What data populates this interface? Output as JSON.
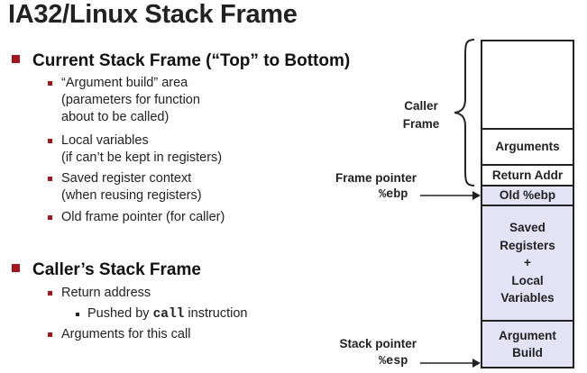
{
  "title": "IA32/Linux Stack Frame",
  "section1": {
    "heading": "Current Stack Frame (“Top” to Bottom)",
    "items": [
      {
        "line1": "“Argument build” area",
        "line2": "(parameters for function",
        "line3": "about to be called)"
      },
      {
        "line1": "Local variables",
        "line2": "(if can’t be kept in registers)"
      },
      {
        "line1": "Saved register context",
        "line2": "(when reusing registers)"
      },
      {
        "line1": "Old frame pointer (for caller)"
      }
    ]
  },
  "section2": {
    "heading": "Caller’s Stack Frame",
    "items": [
      {
        "text": "Return address"
      },
      {
        "text": "Arguments for this call"
      }
    ],
    "subitem": {
      "prefix": "Pushed by ",
      "code": "call",
      "suffix": " instruction"
    }
  },
  "diagram": {
    "caller_frame_label_line1": "Caller",
    "caller_frame_label_line2": "Frame",
    "frame_pointer_label": "Frame pointer",
    "frame_pointer_reg": "%ebp",
    "stack_pointer_label": "Stack pointer",
    "stack_pointer_reg": "%esp",
    "cells": {
      "arguments": "Arguments",
      "return_addr": "Return Addr",
      "old_ebp": "Old %ebp",
      "saved_line1": "Saved",
      "saved_line2": "Registers",
      "saved_line3": "+",
      "saved_line4": "Local",
      "saved_line5": "Variables",
      "arg_build_line1": "Argument",
      "arg_build_line2": "Build"
    },
    "colors": {
      "bullet": "#a3161b",
      "callee_fill": "#e4e2f5",
      "caller_fill": "#ffffff"
    }
  }
}
